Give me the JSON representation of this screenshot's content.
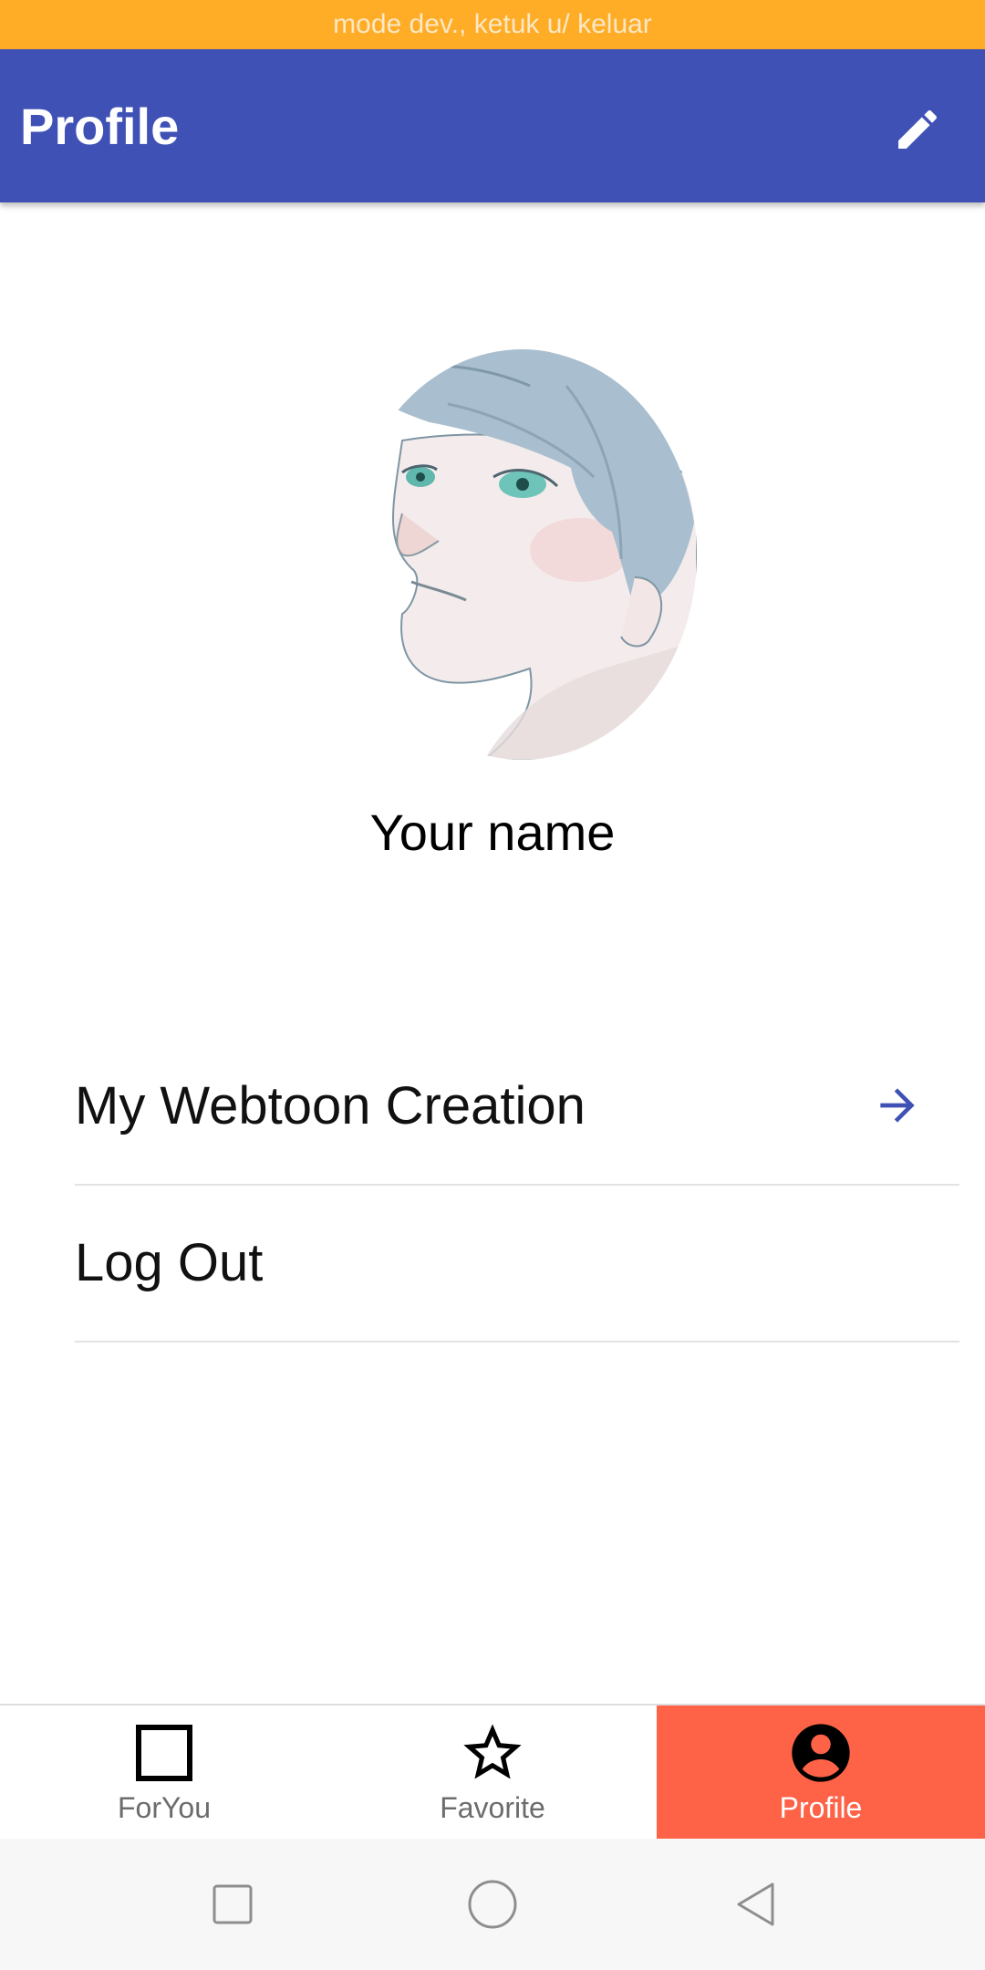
{
  "status_bar": {
    "text": "mode dev., ketuk u/ keluar"
  },
  "app_bar": {
    "title": "Profile",
    "edit_icon": "pencil-icon"
  },
  "profile": {
    "name": "Your name",
    "avatar_icon": "profile-avatar-image"
  },
  "menu": [
    {
      "label": "My Webtoon Creation",
      "icon": "arrow-right-icon"
    },
    {
      "label": "Log Out"
    }
  ],
  "bottom_nav": {
    "tabs": [
      {
        "label": "ForYou",
        "icon": "square-icon"
      },
      {
        "label": "Favorite",
        "icon": "star-icon"
      },
      {
        "label": "Profile",
        "icon": "account-circle-icon",
        "active": true
      }
    ]
  },
  "system_nav": {
    "buttons": [
      "recents-icon",
      "home-icon",
      "back-icon"
    ]
  },
  "colors": {
    "status_bar": "#FFAC26",
    "app_bar": "#3F51B5",
    "active_tab": "#FF6347",
    "arrow": "#3F51B5"
  }
}
